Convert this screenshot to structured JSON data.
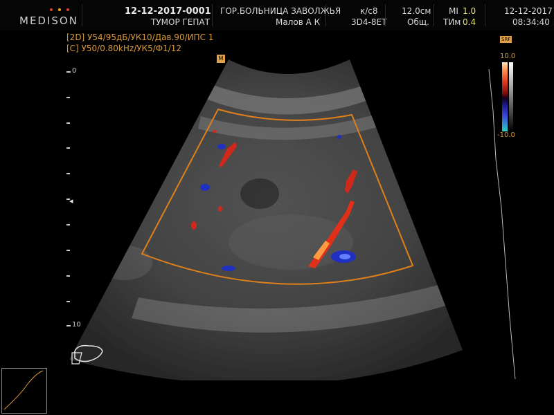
{
  "header": {
    "brand": "MEDISON",
    "brand_dot_colors": [
      "#e04030",
      "#f0a020",
      "#e04030"
    ],
    "patient_id": "12-12-2017-0001",
    "exam_note": "ТУМОР ГЕПАТ",
    "hospital": "ГОР.БОЛЬНИЦА ЗАВОЛЖЬЯ",
    "operator": "Малов А К",
    "preset": "к/с8",
    "probe": "3D4-8ET",
    "depth": "12.0см",
    "application": "Общ.",
    "mi_label": "MI",
    "mi_value": "1.0",
    "tim_label": "ТИм",
    "tim_value": "0.4",
    "date": "12-12-2017",
    "time": "08:34:40"
  },
  "params": {
    "mode_2d": "[2D]",
    "line_2d": "У54/95дБ/УК10/Дав.90/ИПС 1",
    "mode_color": "[C]",
    "line_color": "У50/0.80kHz/УК5/Ф1/12"
  },
  "depth_scale": {
    "top": "0",
    "bottom": "10"
  },
  "color_scale": {
    "max": "10.0",
    "min": "-10.0",
    "badge": "SRF"
  },
  "focus_marker": "M",
  "colors": {
    "param_text": "#d89a3a",
    "value_highlight": "#e8e070",
    "roi_box": "#e0801a",
    "doppler_red": "#e0301a",
    "doppler_blue": "#2030c0"
  }
}
